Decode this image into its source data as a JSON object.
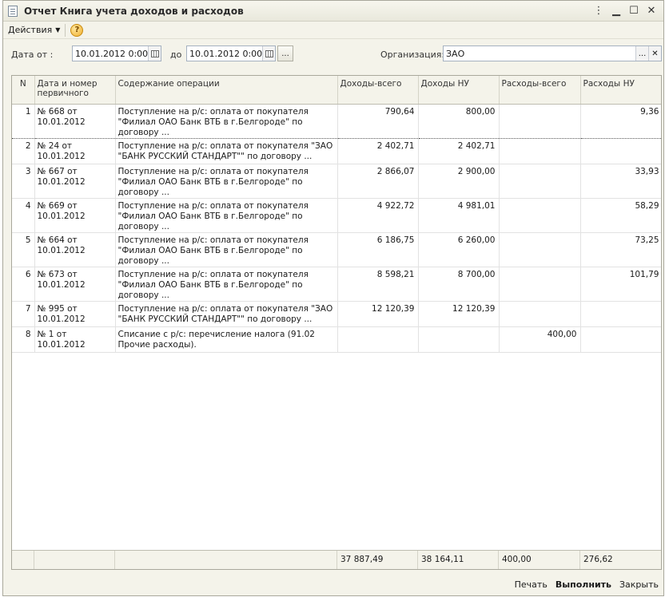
{
  "window": {
    "title": "Отчет Книга учета доходов и расходов"
  },
  "toolbar": {
    "actions_label": "Действия",
    "help_glyph": "?"
  },
  "filters": {
    "date_from_label": "Дата от :",
    "date_from_value": "10.01.2012  0:00:00",
    "date_to_label": "до",
    "date_to_value": "10.01.2012  0:00:00",
    "period_button": "...",
    "org_label": "Организация:",
    "org_value": "ЗАО",
    "org_select": "...",
    "org_clear": "✕"
  },
  "table": {
    "columns": [
      "N",
      "Дата и номер первичного",
      "Содержание операции",
      "Доходы-всего",
      "Доходы НУ",
      "Расходы-всего",
      "Расходы НУ"
    ],
    "rows": [
      {
        "n": "1",
        "doc": "№ 668 от 10.01.2012",
        "content": "Поступление на р/с: оплата от покупателя \"Филиал ОАО Банк ВТБ в г.Белгороде\" по договору ...",
        "inc_total": "790,64",
        "inc_nu": "800,00",
        "exp_total": "",
        "exp_nu": "9,36"
      },
      {
        "n": "2",
        "doc": "№ 24 от 10.01.2012",
        "content": "Поступление на р/с: оплата от покупателя \"ЗАО \"БАНК РУССКИЙ СТАНДАРТ\"\" по договору ...",
        "inc_total": "2 402,71",
        "inc_nu": "2 402,71",
        "exp_total": "",
        "exp_nu": ""
      },
      {
        "n": "3",
        "doc": "№ 667 от 10.01.2012",
        "content": "Поступление на р/с: оплата от покупателя \"Филиал ОАО Банк ВТБ в г.Белгороде\" по договору ...",
        "inc_total": "2 866,07",
        "inc_nu": "2 900,00",
        "exp_total": "",
        "exp_nu": "33,93"
      },
      {
        "n": "4",
        "doc": "№ 669 от 10.01.2012",
        "content": "Поступление на р/с: оплата от покупателя \"Филиал ОАО Банк ВТБ в г.Белгороде\" по договору ...",
        "inc_total": "4 922,72",
        "inc_nu": "4 981,01",
        "exp_total": "",
        "exp_nu": "58,29"
      },
      {
        "n": "5",
        "doc": "№ 664 от 10.01.2012",
        "content": "Поступление на р/с: оплата от покупателя \"Филиал ОАО Банк ВТБ в г.Белгороде\" по договору ...",
        "inc_total": "6 186,75",
        "inc_nu": "6 260,00",
        "exp_total": "",
        "exp_nu": "73,25"
      },
      {
        "n": "6",
        "doc": "№ 673 от 10.01.2012",
        "content": "Поступление на р/с: оплата от покупателя \"Филиал ОАО Банк ВТБ в г.Белгороде\" по договору ...",
        "inc_total": "8 598,21",
        "inc_nu": "8 700,00",
        "exp_total": "",
        "exp_nu": "101,79"
      },
      {
        "n": "7",
        "doc": "№ 995 от 10.01.2012",
        "content": "Поступление на р/с: оплата от покупателя \"ЗАО \"БАНК РУССКИЙ СТАНДАРТ\"\" по договору ...",
        "inc_total": "12 120,39",
        "inc_nu": "12 120,39",
        "exp_total": "",
        "exp_nu": ""
      },
      {
        "n": "8",
        "doc": "№ 1 от 10.01.2012",
        "content": "Списание с р/с: перечисление налога (91.02 Прочие расходы).",
        "inc_total": "",
        "inc_nu": "",
        "exp_total": "400,00",
        "exp_nu": ""
      }
    ],
    "totals": {
      "inc_total": "37 887,49",
      "inc_nu": "38 164,11",
      "exp_total": "400,00",
      "exp_nu": "276,62"
    }
  },
  "buttons": {
    "print": "Печать",
    "run": "Выполнить",
    "close": "Закрыть"
  }
}
